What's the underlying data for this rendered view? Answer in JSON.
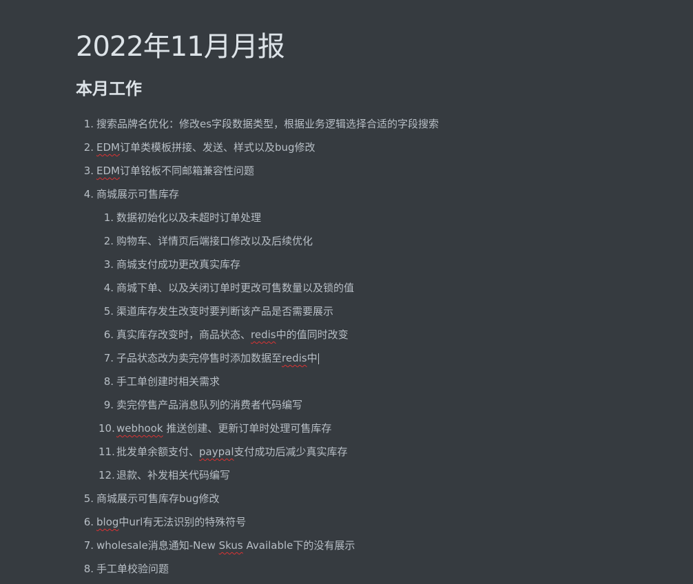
{
  "doc": {
    "title": "2022年11月月报",
    "section_heading": "本月工作",
    "items": [
      {
        "num": "1.",
        "text": "搜索品牌名优化：修改es字段数据类型，根据业务逻辑选择合适的字段搜索"
      },
      {
        "num": "2.",
        "pre": "",
        "spell": "EDM",
        "post": "订单类模板拼接、发送、样式以及bug修改"
      },
      {
        "num": "3.",
        "pre": "",
        "spell": "EDM",
        "post": "订单铭板不同邮箱兼容性问题"
      },
      {
        "num": "4.",
        "text": "商城展示可售库存"
      },
      {
        "num": "5.",
        "text": "商城展示可售库存bug修改"
      },
      {
        "num": "6.",
        "pre": "",
        "spell": "blog",
        "post": "中url有无法识别的特殊符号"
      },
      {
        "num": "7.",
        "pre": "wholesale消息通知-New ",
        "spell": "Skus",
        "post": " Available下的没有展示"
      },
      {
        "num": "8.",
        "text": "手工单校验问题"
      }
    ],
    "subitems": [
      {
        "num": "1.",
        "text": "数据初始化以及未超时订单处理"
      },
      {
        "num": "2.",
        "text": "购物车、详情页后端接口修改以及后续优化"
      },
      {
        "num": "3.",
        "text": "商城支付成功更改真实库存"
      },
      {
        "num": "4.",
        "text": "商城下单、以及关闭订单时更改可售数量以及锁的值"
      },
      {
        "num": "5.",
        "text": "渠道库存发生改变时要判断该产品是否需要展示"
      },
      {
        "num": "6.",
        "pre": "真实库存改变时，商品状态、",
        "spell": "redis",
        "post": "中的值同时改变"
      },
      {
        "num": "7.",
        "pre": "子品状态改为卖完停售时添加数据至",
        "spell": "redis",
        "post": "中"
      },
      {
        "num": "8.",
        "text": "手工单创建时相关需求"
      },
      {
        "num": "9.",
        "text": "卖完停售产品消息队列的消费者代码编写"
      },
      {
        "num": "10.",
        "pre": "",
        "spell": "webhook",
        "post": " 推送创建、更新订单时处理可售库存"
      },
      {
        "num": "11.",
        "pre": "批发单余额支付、",
        "spell": "paypal",
        "post": "支付成功后减少真实库存"
      },
      {
        "num": "12.",
        "text": "退款、补发相关代码编写"
      }
    ]
  }
}
